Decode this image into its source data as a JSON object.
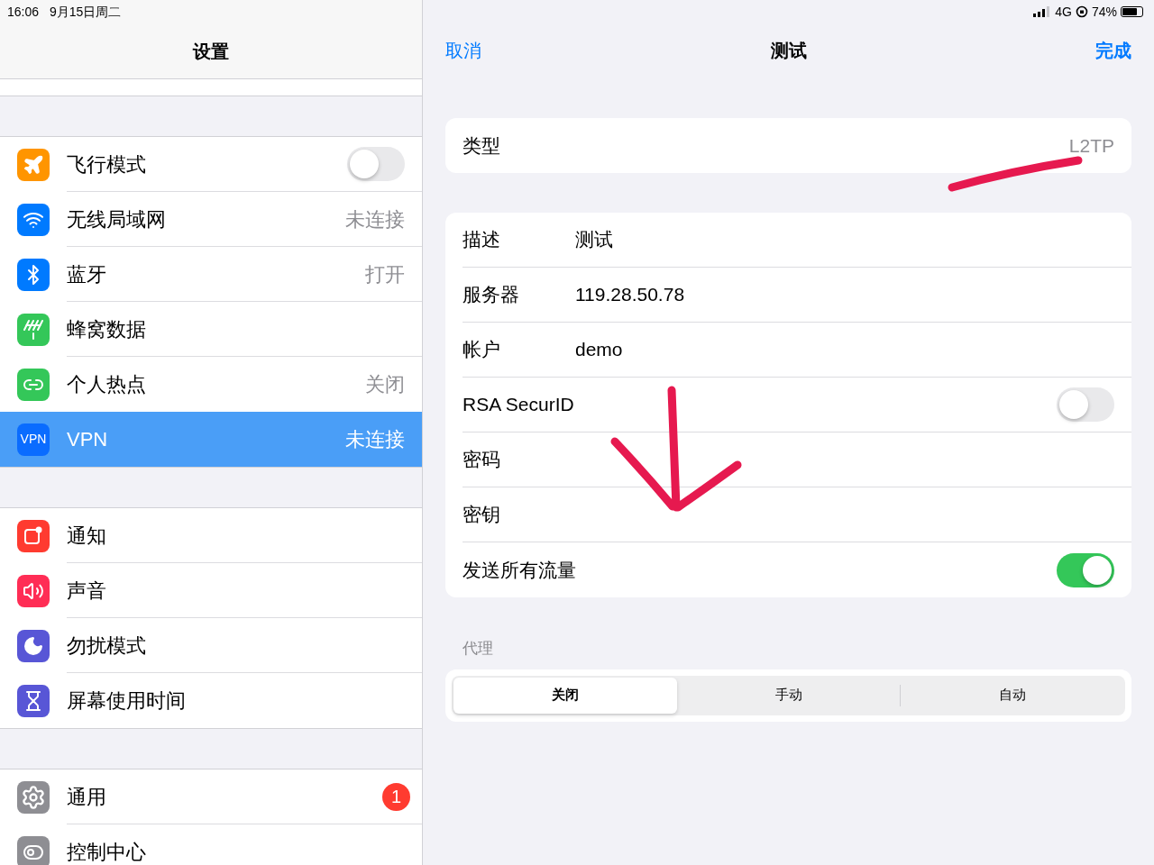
{
  "status_bar": {
    "time": "16:06",
    "date": "9月15日周二",
    "network": "4G",
    "battery": "74%"
  },
  "sidebar": {
    "title": "设置",
    "groups": [
      [
        {
          "label": "飞行模式",
          "kind": "toggle",
          "on": false,
          "selected": false
        },
        {
          "label": "无线局域网",
          "kind": "value",
          "value": "未连接",
          "selected": false
        },
        {
          "label": "蓝牙",
          "kind": "value",
          "value": "打开",
          "selected": false
        },
        {
          "label": "蜂窝数据",
          "kind": "plain",
          "selected": false
        },
        {
          "label": "个人热点",
          "kind": "value",
          "value": "关闭",
          "selected": false
        },
        {
          "icon_text": "VPN",
          "label": "VPN",
          "kind": "value",
          "value": "未连接",
          "selected": true
        }
      ],
      [
        {
          "label": "通知",
          "kind": "plain",
          "selected": false
        },
        {
          "label": "声音",
          "kind": "plain",
          "selected": false
        },
        {
          "label": "勿扰模式",
          "kind": "plain",
          "selected": false
        },
        {
          "label": "屏幕使用时间",
          "kind": "plain",
          "selected": false
        }
      ],
      [
        {
          "label": "通用",
          "kind": "badge",
          "value": "1",
          "selected": false
        },
        {
          "label": "控制中心",
          "kind": "plain",
          "selected": false
        }
      ]
    ]
  },
  "detail": {
    "cancel": "取消",
    "title": "测试",
    "done": "完成",
    "type_row": {
      "label": "类型",
      "value": "L2TP"
    },
    "fields": [
      {
        "kind": "text",
        "label": "描述",
        "value": "测试"
      },
      {
        "kind": "text",
        "label": "服务器",
        "value": "119.28.50.78"
      },
      {
        "kind": "text",
        "label": "帐户",
        "value": "demo"
      },
      {
        "kind": "toggle",
        "label": "RSA SecurID",
        "on": false
      },
      {
        "kind": "empty",
        "label": "密码"
      },
      {
        "kind": "empty",
        "label": "密钥"
      },
      {
        "kind": "toggle",
        "label": "发送所有流量",
        "on": true
      }
    ],
    "proxy": {
      "label": "代理",
      "options": [
        {
          "label": "关闭",
          "selected": true
        },
        {
          "label": "手动",
          "selected": false
        },
        {
          "label": "自动",
          "selected": false
        }
      ]
    }
  }
}
